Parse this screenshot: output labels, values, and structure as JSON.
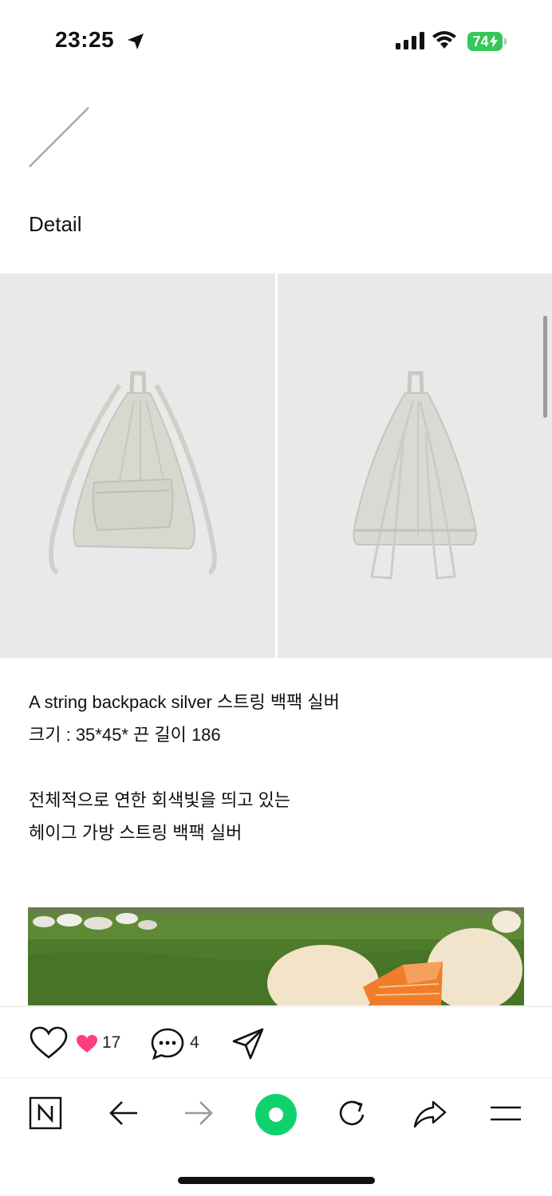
{
  "status_bar": {
    "time": "23:25",
    "battery": "74"
  },
  "post": {
    "title": "Detail",
    "description_lines": [
      "A string backpack silver 스트링 백팩 실버",
      "크기 : 35*45* 끈 길이 186",
      "",
      "전체적으로 연한 회색빛을 띄고 있는",
      "헤이그 가방 스트링 백팩 실버"
    ]
  },
  "actions": {
    "like_count": "17",
    "comment_count": "4"
  },
  "toolbar": {
    "items": [
      "naver-home",
      "back",
      "forward",
      "green-dot",
      "refresh",
      "share",
      "menu"
    ]
  },
  "colors": {
    "accent_green": "#0fd26e",
    "heart_pink": "#ff3d7f",
    "battery_green": "#34c759"
  }
}
